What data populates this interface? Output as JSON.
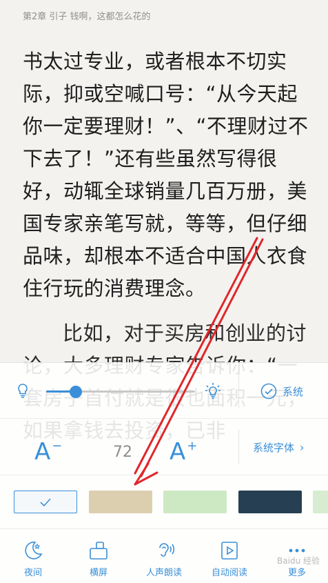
{
  "chapter_title": "第2章 引子 钱啊，这都怎么花的",
  "body_paragraphs": [
    "书太过专业，或者根本不切实际，抑或空喊口号：“从今天起你一定要理财！”、“不理财过不下去了！”还有些虽然写得很好，动辄全球销量几百万册，美国专家亲笔写就，等等，但仔细品味，却根本不适合中国人衣食住行玩的消费理念。",
    "比如，对于买房和创业的讨论，大多理财专家告诉你：“一套房子首付就是很也面积一元，如果拿钱去投资，已非"
  ],
  "brightness": {
    "level": 0.2,
    "system_label": "系统",
    "color_accent": "#3a8fd8"
  },
  "font": {
    "decrease_label": "A",
    "decrease_sign": "−",
    "size_value": "72",
    "increase_label": "A",
    "increase_sign": "+",
    "family_label": "系统字体"
  },
  "themes": [
    {
      "name": "white",
      "color": "#f5f8fb",
      "selected": true
    },
    {
      "name": "parchment",
      "color": "#dccfb0",
      "selected": false
    },
    {
      "name": "green",
      "color": "#cde9c3",
      "selected": false
    },
    {
      "name": "navy",
      "color": "#263f52",
      "selected": false
    },
    {
      "name": "light-green",
      "color": "#d7ecd0",
      "selected": false
    }
  ],
  "toolbar": {
    "night_label": "夜间",
    "landscape_label": "横屏",
    "tts_label": "人声朗读",
    "autoread_label": "自动阅读",
    "more_label": "更多"
  },
  "watermark": "Baidu 经验"
}
